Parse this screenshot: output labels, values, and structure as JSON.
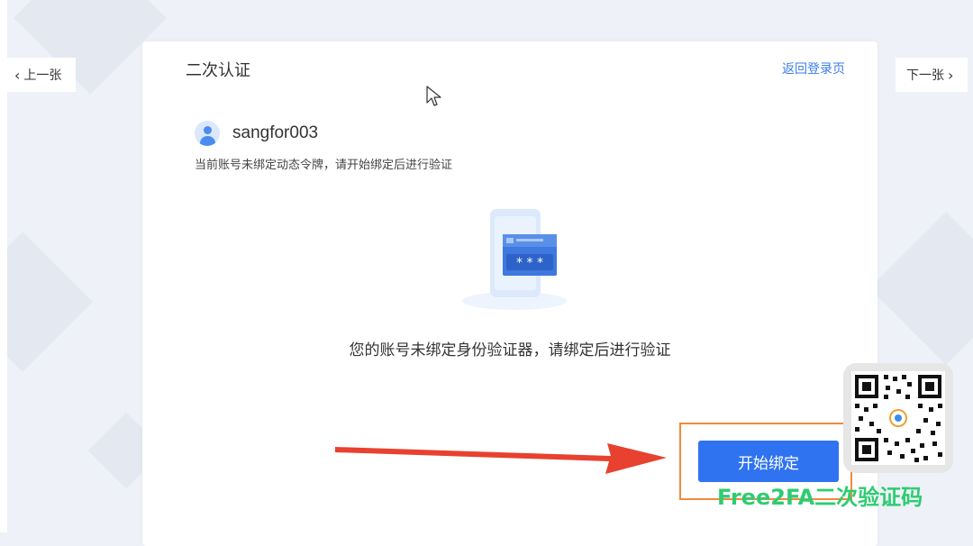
{
  "nav": {
    "prev_label": "上一张",
    "next_label": "下一张"
  },
  "card": {
    "title": "二次认证",
    "back_link": "返回登录页",
    "username": "sangfor003",
    "hint": "当前账号未绑定动态令牌，请开始绑定后进行验证",
    "message": "您的账号未绑定身份验证器，请绑定后进行验证",
    "primary_button": "开始绑定"
  },
  "watermark": {
    "text": "Free2FA二次验证码"
  },
  "colors": {
    "accent": "#2f73f0",
    "link": "#3a7ee8",
    "highlight": "#f08a3c",
    "arrow": "#e8412f",
    "watermark": "#2ecc71"
  },
  "icons": [
    "chevron-left-icon",
    "chevron-right-icon",
    "user-avatar-icon",
    "authenticator-illustration",
    "cursor-icon",
    "qr-code"
  ]
}
